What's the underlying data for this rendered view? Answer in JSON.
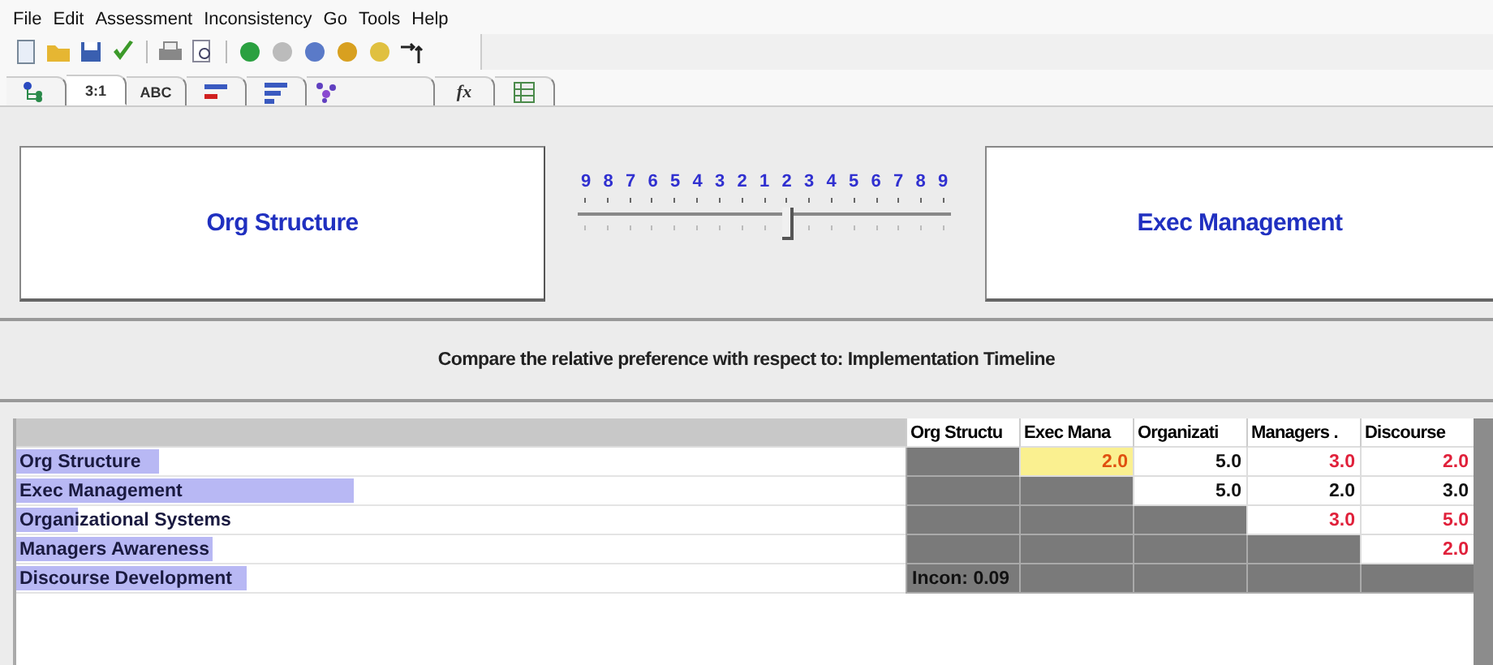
{
  "menu": [
    "File",
    "Edit",
    "Assessment",
    "Inconsistency",
    "Go",
    "Tools",
    "Help"
  ],
  "toolbar": [
    {
      "kind": "new"
    },
    {
      "kind": "open"
    },
    {
      "kind": "save"
    },
    {
      "kind": "check"
    },
    {
      "kind": "print"
    },
    {
      "kind": "preview"
    },
    {
      "kind": "green"
    },
    {
      "kind": "gray"
    },
    {
      "kind": "links"
    },
    {
      "kind": "refresh"
    },
    {
      "kind": "bell"
    },
    {
      "kind": "arrows"
    }
  ],
  "tabs": [
    {
      "kind": "tree",
      "selected": false
    },
    {
      "kind": "text",
      "label": "3:1",
      "selected": true
    },
    {
      "kind": "text",
      "label": "ABC",
      "selected": false
    },
    {
      "kind": "bars-red",
      "selected": false
    },
    {
      "kind": "bars",
      "selected": false
    },
    {
      "kind": "star",
      "selected": false
    },
    {
      "kind": "text",
      "label": "fx",
      "selected": false
    },
    {
      "kind": "grid",
      "selected": false
    }
  ],
  "left_element": "Org Structure",
  "right_element": "Exec Management",
  "scale": {
    "labels": [
      "9",
      "8",
      "7",
      "6",
      "5",
      "4",
      "3",
      "2",
      "1",
      "2",
      "3",
      "4",
      "5",
      "6",
      "7",
      "8",
      "9"
    ],
    "level": 0.56
  },
  "question": "Compare the relative preference with respect to: Implementation Timeline",
  "table": {
    "columns": [
      "Org Structu",
      "Exec Mana",
      "Organizati",
      "Managers .",
      "Discourse"
    ],
    "rows": [
      {
        "label": "Org Structure",
        "level": 0.16,
        "cells": [
          {
            "kind": "empty"
          },
          {
            "kind": "value",
            "text": "2.0",
            "inverted": true,
            "selected": true
          },
          {
            "kind": "value",
            "text": "5.0",
            "inverted": false,
            "selected": false
          },
          {
            "kind": "value",
            "text": "3.0",
            "inverted": true,
            "selected": false
          },
          {
            "kind": "value",
            "text": "2.0",
            "inverted": true,
            "selected": false
          }
        ]
      },
      {
        "label": "Exec Management",
        "level": 0.38,
        "cells": [
          {
            "kind": "empty"
          },
          {
            "kind": "empty"
          },
          {
            "kind": "value",
            "text": "5.0",
            "inverted": false,
            "selected": false
          },
          {
            "kind": "value",
            "text": "2.0",
            "inverted": false,
            "selected": false
          },
          {
            "kind": "value",
            "text": "3.0",
            "inverted": false,
            "selected": false
          }
        ]
      },
      {
        "label": "Organizational Systems",
        "level": 0.07,
        "cells": [
          {
            "kind": "empty"
          },
          {
            "kind": "empty"
          },
          {
            "kind": "empty"
          },
          {
            "kind": "value",
            "text": "3.0",
            "inverted": true,
            "selected": false
          },
          {
            "kind": "value",
            "text": "5.0",
            "inverted": true,
            "selected": false
          }
        ]
      },
      {
        "label": "Managers Awareness",
        "level": 0.22,
        "cells": [
          {
            "kind": "empty"
          },
          {
            "kind": "empty"
          },
          {
            "kind": "empty"
          },
          {
            "kind": "empty"
          },
          {
            "kind": "value",
            "text": "2.0",
            "inverted": true,
            "selected": false
          }
        ]
      },
      {
        "label": "Discourse Development",
        "level": 0.26,
        "cells": [
          {
            "kind": "note",
            "text": "Incon: 0.09"
          },
          {
            "kind": "empty"
          },
          {
            "kind": "empty"
          },
          {
            "kind": "empty"
          },
          {
            "kind": "empty"
          }
        ]
      }
    ]
  }
}
